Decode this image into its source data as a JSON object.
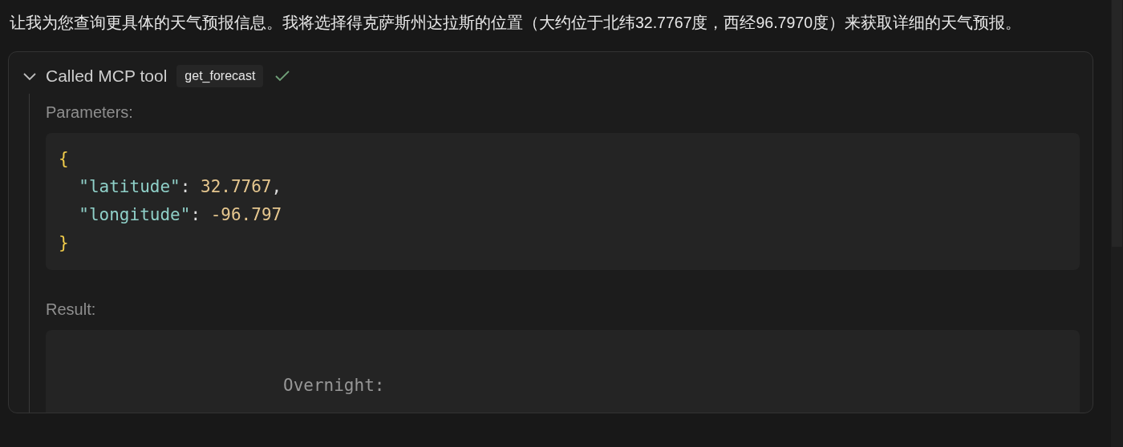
{
  "message": {
    "text": "让我为您查询更具体的天气预报信息。我将选择得克萨斯州达拉斯的位置（大约位于北纬32.7767度，西经96.7970度）来获取详细的天气预报。"
  },
  "tool_call": {
    "expanded": true,
    "title": "Called MCP tool",
    "tool_name": "get_forecast",
    "succeeded": true,
    "parameters_label": "Parameters:",
    "parameters_code": [
      [
        {
          "text": "{",
          "kind": "brace"
        }
      ],
      [
        {
          "text": "  \"latitude\"",
          "kind": "key"
        },
        {
          "text": ": ",
          "kind": "plain"
        },
        {
          "text": "32.7767",
          "kind": "number"
        },
        {
          "text": ",",
          "kind": "plain"
        }
      ],
      [
        {
          "text": "  \"longitude\"",
          "kind": "key"
        },
        {
          "text": ": ",
          "kind": "plain"
        },
        {
          "text": "-96.797",
          "kind": "number"
        }
      ],
      [
        {
          "text": "}",
          "kind": "brace"
        }
      ]
    ],
    "result_label": "Result:",
    "result_lines": [
      "Overnight:"
    ]
  }
}
